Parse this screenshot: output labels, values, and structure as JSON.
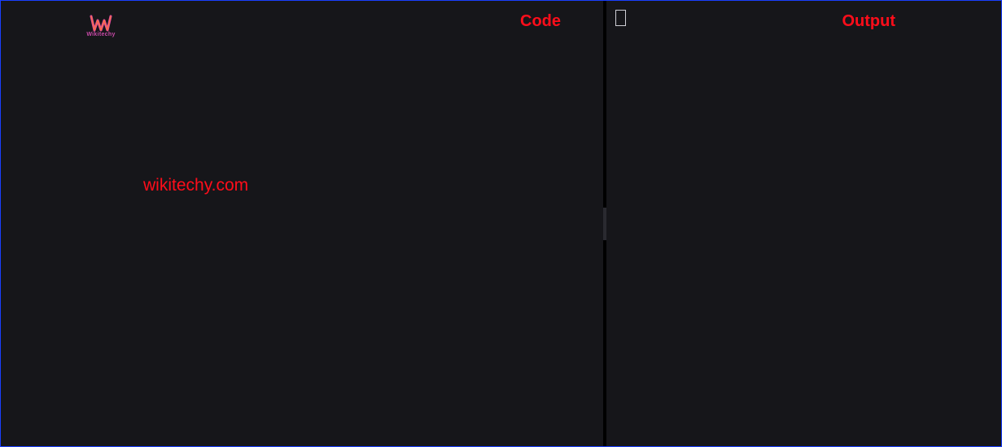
{
  "logo": {
    "brand_text": "Wikitechy"
  },
  "left_pane": {
    "header_label": "Code",
    "watermark": "wikitechy.com"
  },
  "right_pane": {
    "header_label": "Output"
  }
}
